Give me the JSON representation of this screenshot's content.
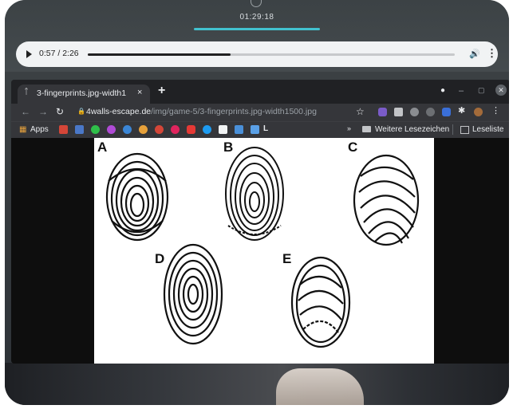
{
  "timer": "01:29:18",
  "audio": {
    "time_display": "0:57 / 2:26",
    "progress_fraction": 0.39
  },
  "browser": {
    "tab_title": "3-fingerprints.jpg-width1",
    "tab_close": "×",
    "new_tab": "+",
    "address": {
      "host": "4walls-escape.de",
      "path": "/img/game-5/3-fingerprints.jpg-width1500.jpg"
    },
    "bookmarks": {
      "apps_label": "Apps",
      "chevron": "»",
      "other_folder_label": "Weitere Lesezeichen",
      "reading_list_label": "Leseliste"
    },
    "window_controls": {
      "minimize": "–",
      "maximize": "▢",
      "close": "✕"
    }
  },
  "fingerprints": {
    "labels": [
      "A",
      "B",
      "C",
      "D",
      "E"
    ]
  },
  "colors": {
    "accent_timer_bar": "#42c2cf",
    "browser_dark": "#202124",
    "toolbar": "#35363a"
  },
  "icons": [
    "play-icon",
    "volume-icon",
    "more-vert-icon",
    "back-icon",
    "forward-icon",
    "reload-icon",
    "lock-icon",
    "star-icon",
    "apps-grid-icon",
    "folder-icon",
    "reading-list-icon"
  ]
}
